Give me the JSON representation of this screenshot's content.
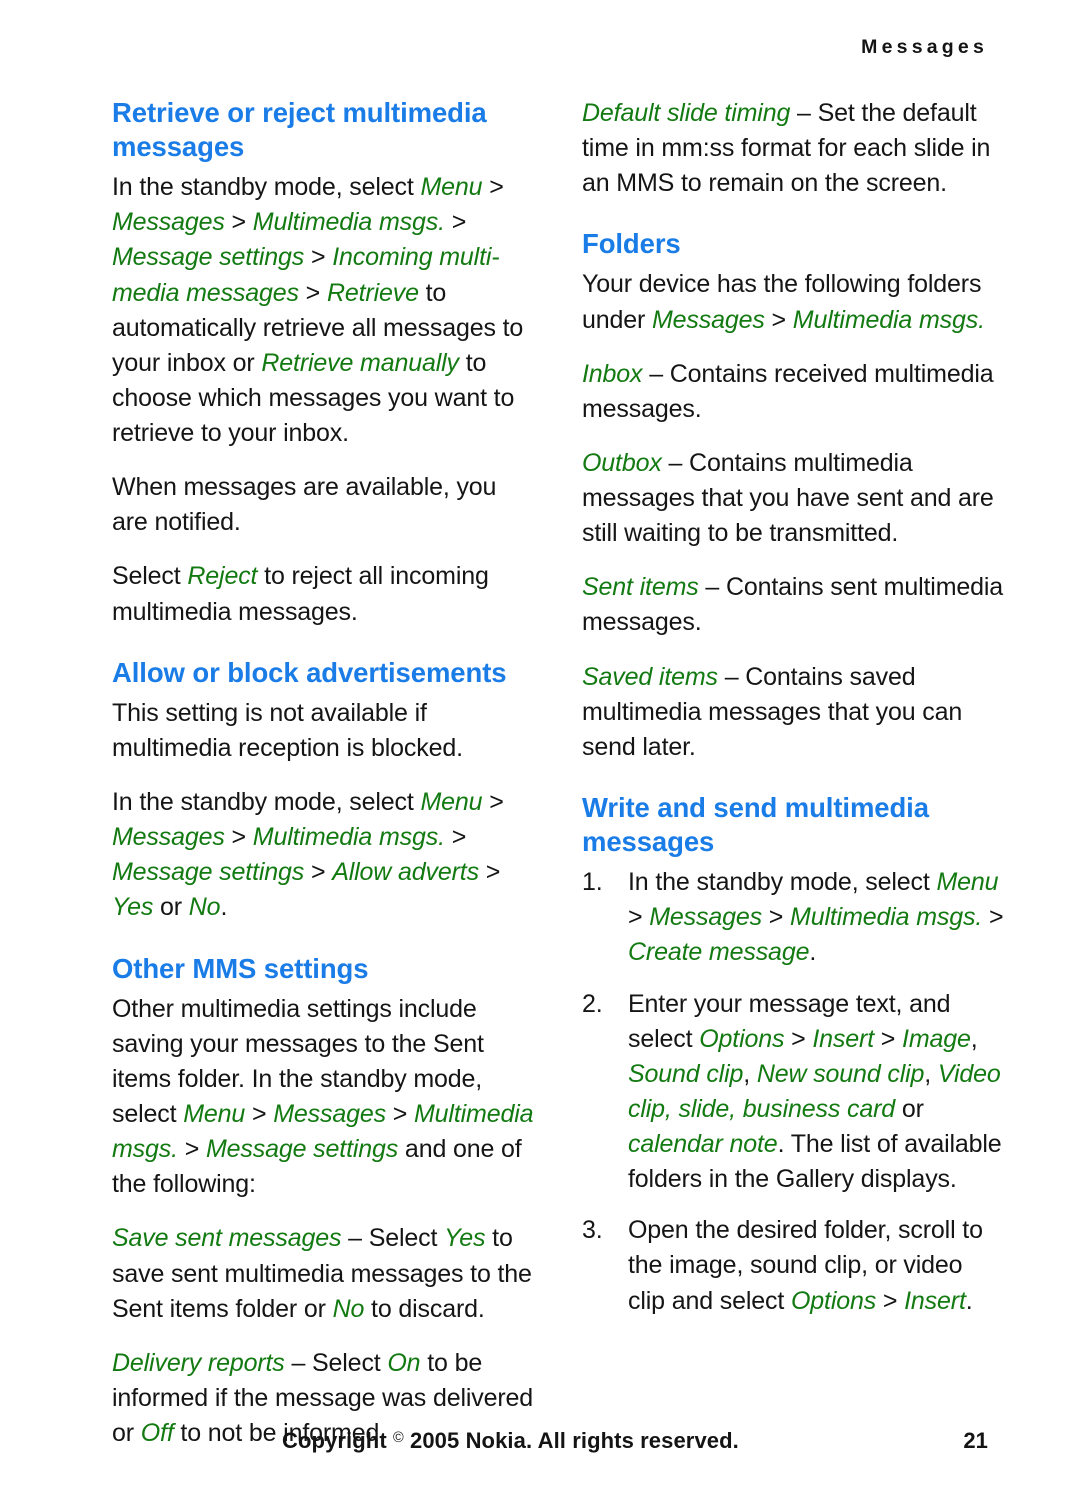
{
  "header": {
    "running_title": "Messages"
  },
  "left_column": {
    "blocks": [
      {
        "type": "heading",
        "text": "Retrieve or reject multimedia messages"
      },
      {
        "type": "paragraph",
        "runs": [
          {
            "style": "plain",
            "text": "In the standby mode, select "
          },
          {
            "style": "ui",
            "text": "Menu"
          },
          {
            "style": "plain",
            "text": " > "
          },
          {
            "style": "ui",
            "text": "Messages"
          },
          {
            "style": "plain",
            "text": " > "
          },
          {
            "style": "ui",
            "text": "Multimedia msgs."
          },
          {
            "style": "plain",
            "text": " > "
          },
          {
            "style": "ui",
            "text": "Message settings"
          },
          {
            "style": "plain",
            "text": " > "
          },
          {
            "style": "ui",
            "text": "Incoming multi- media messages"
          },
          {
            "style": "plain",
            "text": " > "
          },
          {
            "style": "ui",
            "text": "Retrieve"
          },
          {
            "style": "plain",
            "text": " to automatically retrieve all messages to your inbox or "
          },
          {
            "style": "ui",
            "text": "Retrieve manually"
          },
          {
            "style": "plain",
            "text": " to choose which messages you want to retrieve to your inbox."
          }
        ]
      },
      {
        "type": "paragraph",
        "runs": [
          {
            "style": "plain",
            "text": "When messages are available, you are notified."
          }
        ]
      },
      {
        "type": "paragraph",
        "runs": [
          {
            "style": "plain",
            "text": "Select "
          },
          {
            "style": "ui",
            "text": "Reject"
          },
          {
            "style": "plain",
            "text": " to reject all incoming multimedia messages."
          }
        ]
      },
      {
        "type": "heading",
        "text": "Allow or block advertisements"
      },
      {
        "type": "paragraph",
        "runs": [
          {
            "style": "plain",
            "text": "This setting is not available if multimedia reception is blocked."
          }
        ]
      },
      {
        "type": "paragraph",
        "runs": [
          {
            "style": "plain",
            "text": "In the standby mode, select "
          },
          {
            "style": "ui",
            "text": "Menu"
          },
          {
            "style": "plain",
            "text": " > "
          },
          {
            "style": "ui",
            "text": "Messages"
          },
          {
            "style": "plain",
            "text": " > "
          },
          {
            "style": "ui",
            "text": "Multimedia msgs."
          },
          {
            "style": "plain",
            "text": " > "
          },
          {
            "style": "ui",
            "text": "Message settings"
          },
          {
            "style": "plain",
            "text": " > "
          },
          {
            "style": "ui",
            "text": "Allow adverts"
          },
          {
            "style": "plain",
            "text": " > "
          },
          {
            "style": "ui",
            "text": "Yes"
          },
          {
            "style": "plain",
            "text": " or "
          },
          {
            "style": "ui",
            "text": "No"
          },
          {
            "style": "plain",
            "text": "."
          }
        ]
      },
      {
        "type": "heading",
        "text": "Other MMS settings"
      },
      {
        "type": "paragraph",
        "runs": [
          {
            "style": "plain",
            "text": "Other multimedia settings include saving your messages to the Sent items folder. In the standby mode, select "
          },
          {
            "style": "ui",
            "text": "Menu"
          },
          {
            "style": "plain",
            "text": " > "
          },
          {
            "style": "ui",
            "text": "Messages"
          },
          {
            "style": "plain",
            "text": " > "
          },
          {
            "style": "ui",
            "text": "Multimedia msgs."
          },
          {
            "style": "plain",
            "text": " > "
          },
          {
            "style": "ui",
            "text": "Message settings"
          },
          {
            "style": "plain",
            "text": " and one of the following:"
          }
        ]
      },
      {
        "type": "paragraph",
        "runs": [
          {
            "style": "ui",
            "text": "Save sent messages"
          },
          {
            "style": "plain",
            "text": " – Select "
          },
          {
            "style": "ui",
            "text": "Yes"
          },
          {
            "style": "plain",
            "text": " to save sent multimedia messages to the Sent items folder or "
          },
          {
            "style": "ui",
            "text": "No"
          },
          {
            "style": "plain",
            "text": " to discard."
          }
        ]
      },
      {
        "type": "paragraph",
        "runs": [
          {
            "style": "ui",
            "text": "Delivery reports"
          },
          {
            "style": "plain",
            "text": " – Select "
          },
          {
            "style": "ui",
            "text": "On"
          },
          {
            "style": "plain",
            "text": " to be informed if the message was delivered or "
          },
          {
            "style": "ui",
            "text": "Off"
          },
          {
            "style": "plain",
            "text": " to not be informed."
          }
        ]
      }
    ]
  },
  "right_column": {
    "blocks": [
      {
        "type": "paragraph",
        "runs": [
          {
            "style": "ui",
            "text": "Default slide timing"
          },
          {
            "style": "plain",
            "text": " – Set the default time in mm:ss format for each slide in an MMS to remain on the screen."
          }
        ]
      },
      {
        "type": "heading",
        "text": "Folders"
      },
      {
        "type": "paragraph",
        "runs": [
          {
            "style": "plain",
            "text": "Your device has the following folders under "
          },
          {
            "style": "ui",
            "text": "Messages"
          },
          {
            "style": "plain",
            "text": " > "
          },
          {
            "style": "ui",
            "text": "Multimedia msgs."
          }
        ]
      },
      {
        "type": "paragraph",
        "runs": [
          {
            "style": "ui",
            "text": "Inbox"
          },
          {
            "style": "plain",
            "text": " – Contains received multimedia messages."
          }
        ]
      },
      {
        "type": "paragraph",
        "runs": [
          {
            "style": "ui",
            "text": "Outbox"
          },
          {
            "style": "plain",
            "text": " – Contains multimedia messages that you have sent and are still waiting to be transmitted."
          }
        ]
      },
      {
        "type": "paragraph",
        "runs": [
          {
            "style": "ui",
            "text": "Sent items"
          },
          {
            "style": "plain",
            "text": " – Contains sent multimedia messages."
          }
        ]
      },
      {
        "type": "paragraph",
        "runs": [
          {
            "style": "ui",
            "text": "Saved items"
          },
          {
            "style": "plain",
            "text": " – Contains saved multimedia messages that you can send later."
          }
        ]
      },
      {
        "type": "heading",
        "text": "Write and send multimedia messages"
      },
      {
        "type": "ordered_list",
        "items": [
          {
            "number": "1.",
            "runs": [
              {
                "style": "plain",
                "text": "In the standby mode, select "
              },
              {
                "style": "ui",
                "text": "Menu"
              },
              {
                "style": "plain",
                "text": " > "
              },
              {
                "style": "ui",
                "text": "Messages"
              },
              {
                "style": "plain",
                "text": " > "
              },
              {
                "style": "ui",
                "text": "Multimedia msgs."
              },
              {
                "style": "plain",
                "text": " > "
              },
              {
                "style": "ui",
                "text": "Create message"
              },
              {
                "style": "plain",
                "text": "."
              }
            ]
          },
          {
            "number": "2.",
            "runs": [
              {
                "style": "plain",
                "text": "Enter your message text, and select "
              },
              {
                "style": "ui",
                "text": "Options"
              },
              {
                "style": "plain",
                "text": " > "
              },
              {
                "style": "ui",
                "text": "Insert"
              },
              {
                "style": "plain",
                "text": " > "
              },
              {
                "style": "ui",
                "text": "Image"
              },
              {
                "style": "plain",
                "text": ", "
              },
              {
                "style": "ui",
                "text": "Sound clip"
              },
              {
                "style": "plain",
                "text": ", "
              },
              {
                "style": "ui",
                "text": "New sound clip"
              },
              {
                "style": "plain",
                "text": ", "
              },
              {
                "style": "ui",
                "text": "Video clip, slide, business card"
              },
              {
                "style": "plain",
                "text": " or "
              },
              {
                "style": "ui",
                "text": "calendar note"
              },
              {
                "style": "plain",
                "text": ". The list of available folders in the Gallery displays."
              }
            ]
          },
          {
            "number": "3.",
            "runs": [
              {
                "style": "plain",
                "text": "Open the desired folder, scroll to the image, sound clip, or video clip and select "
              },
              {
                "style": "ui",
                "text": "Options"
              },
              {
                "style": "plain",
                "text": " > "
              },
              {
                "style": "ui",
                "text": "Insert"
              },
              {
                "style": "plain",
                "text": "."
              }
            ]
          }
        ]
      }
    ]
  },
  "footer": {
    "copyright_before": "Copyright ",
    "copyright_symbol": "©",
    "copyright_after": " 2005 Nokia. All rights reserved.",
    "page_number": "21"
  },
  "colors": {
    "heading_blue": "#1a7ce6",
    "ui_term_green": "#137a12",
    "body_black": "#151515"
  }
}
